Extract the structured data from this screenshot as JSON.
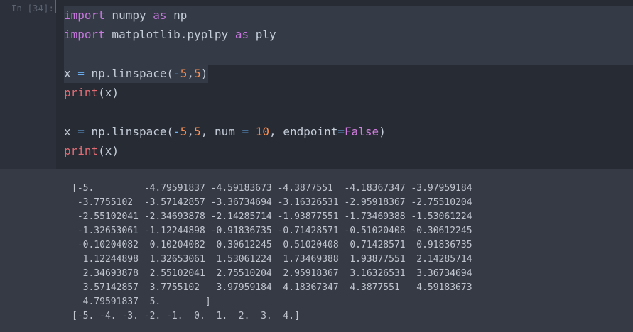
{
  "cell": {
    "prompt": "In [34]:",
    "code": {
      "l1_import": "import",
      "l1_mod": " numpy ",
      "l1_as": "as",
      "l1_alias": " np",
      "l2_import": "import",
      "l2_mod": " matplotlib.pyplpy ",
      "l2_as": "as",
      "l2_alias": " ply",
      "l4_a": "x ",
      "l4_eq": "=",
      "l4_b": " np.linspace(",
      "l4_neg": "-",
      "l4_n1": "5",
      "l4_c": ",",
      "l4_n2": "5",
      "l4_d": ")",
      "l5_fn": "print",
      "l5_rest": "(x)",
      "l7_a": "x ",
      "l7_eq": "=",
      "l7_b": " np.linspace(",
      "l7_neg": "-",
      "l7_n1": "5",
      "l7_c": ",",
      "l7_n2": "5",
      "l7_d": ", num ",
      "l7_eq2": "=",
      "l7_sp": " ",
      "l7_n3": "10",
      "l7_e": ", endpoint",
      "l7_eq3": "=",
      "l7_false": "False",
      "l7_f": ")",
      "l8_fn": "print",
      "l8_rest": "(x)"
    }
  },
  "output": {
    "lines": [
      "[-5.         -4.79591837 -4.59183673 -4.3877551  -4.18367347 -3.97959184",
      " -3.7755102  -3.57142857 -3.36734694 -3.16326531 -2.95918367 -2.75510204",
      " -2.55102041 -2.34693878 -2.14285714 -1.93877551 -1.73469388 -1.53061224",
      " -1.32653061 -1.12244898 -0.91836735 -0.71428571 -0.51020408 -0.30612245",
      " -0.10204082  0.10204082  0.30612245  0.51020408  0.71428571  0.91836735",
      "  1.12244898  1.32653061  1.53061224  1.73469388  1.93877551  2.14285714",
      "  2.34693878  2.55102041  2.75510204  2.95918367  3.16326531  3.36734694",
      "  3.57142857  3.7755102   3.97959184  4.18367347  4.3877551   4.59183673",
      "  4.79591837  5.        ]",
      "[-5. -4. -3. -2. -1.  0.  1.  2.  3.  4.]"
    ]
  },
  "colors": {
    "background": "#2b303b",
    "code_background": "#272b33",
    "output_background": "#353a45",
    "keyword": "#c678dd",
    "function": "#e06c75",
    "number": "#f99157",
    "operator": "#6ab0f3"
  }
}
